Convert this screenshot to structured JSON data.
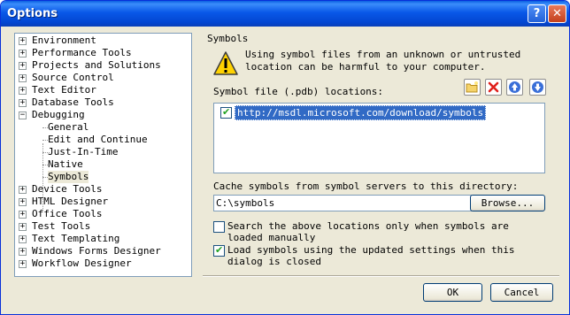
{
  "window": {
    "title": "Options",
    "help_glyph": "?",
    "close_glyph": "✕"
  },
  "tree": {
    "items": [
      {
        "label": "Environment",
        "expander": "+"
      },
      {
        "label": "Performance Tools",
        "expander": "+"
      },
      {
        "label": "Projects and Solutions",
        "expander": "+"
      },
      {
        "label": "Source Control",
        "expander": "+"
      },
      {
        "label": "Text Editor",
        "expander": "+"
      },
      {
        "label": "Database Tools",
        "expander": "+"
      },
      {
        "label": "Debugging",
        "expander": "−"
      },
      {
        "label": "General"
      },
      {
        "label": "Edit and Continue"
      },
      {
        "label": "Just-In-Time"
      },
      {
        "label": "Native"
      },
      {
        "label": "Symbols",
        "selected": true
      },
      {
        "label": "Device Tools",
        "expander": "+"
      },
      {
        "label": "HTML Designer",
        "expander": "+"
      },
      {
        "label": "Office Tools",
        "expander": "+"
      },
      {
        "label": "Test Tools",
        "expander": "+"
      },
      {
        "label": "Text Templating",
        "expander": "+"
      },
      {
        "label": "Windows Forms Designer",
        "expander": "+"
      },
      {
        "label": "Workflow Designer",
        "expander": "+"
      }
    ]
  },
  "symbols": {
    "section_title": "Symbols",
    "warning": "Using symbol files from an unknown or untrusted location can be harmful to your computer.",
    "locations_label": "Symbol file (.pdb) locations:",
    "locations": [
      {
        "url": "http://msdl.microsoft.com/download/symbols",
        "checked": true
      }
    ],
    "toolbar": [
      {
        "name": "new-folder",
        "icon": "folder-icon"
      },
      {
        "name": "delete",
        "icon": "delete-x-icon"
      },
      {
        "name": "move-up",
        "icon": "arrow-up-icon"
      },
      {
        "name": "move-down",
        "icon": "arrow-down-icon"
      }
    ],
    "cache_label": "Cache symbols from symbol servers to this directory:",
    "cache_value": "C:\\symbols",
    "browse_label": "Browse...",
    "search_only_label": "Search the above locations only when symbols are loaded manually",
    "search_only_checked": false,
    "load_updated_label": "Load symbols using the updated settings when this dialog is closed",
    "load_updated_checked": true
  },
  "footer": {
    "ok_label": "OK",
    "cancel_label": "Cancel"
  },
  "colors": {
    "title_bar": "#0a5fe0",
    "selection": "#316ac5",
    "dialog_bg": "#ece9d8"
  }
}
